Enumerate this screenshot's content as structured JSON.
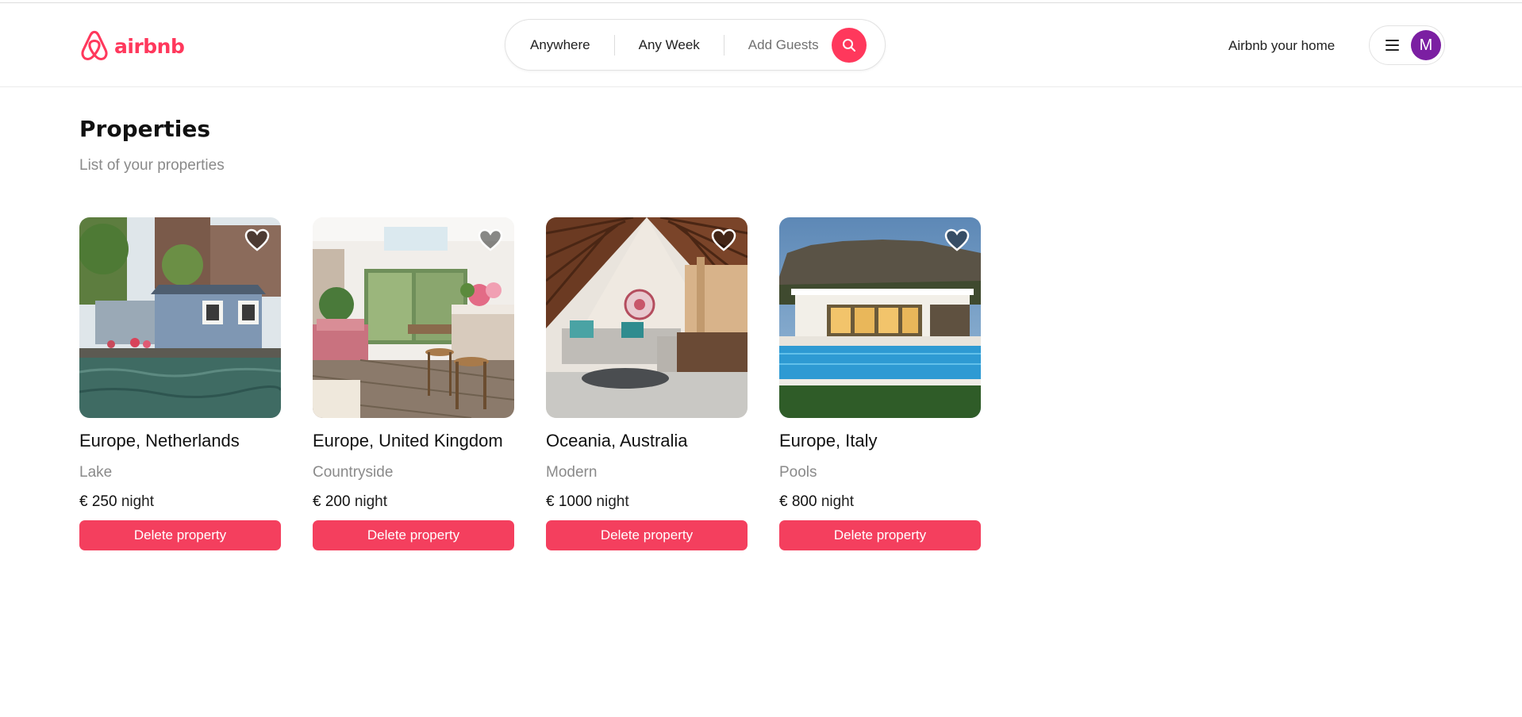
{
  "brand": {
    "name": "airbnb",
    "color": "#ff385c"
  },
  "search": {
    "location_label": "Anywhere",
    "week_label": "Any Week",
    "guests_label": "Add Guests",
    "button_icon": "search-icon"
  },
  "header": {
    "host_link": "Airbnb your home",
    "menu_icon": "hamburger-icon",
    "avatar_initial": "M",
    "avatar_color": "#7b1fa2"
  },
  "page": {
    "title": "Properties",
    "subtitle": "List of your properties"
  },
  "properties": [
    {
      "location": "Europe, Netherlands",
      "category": "Lake",
      "price": "€ 250",
      "unit": "night",
      "action": "Delete property",
      "favorite_icon": "heart-icon"
    },
    {
      "location": "Europe, United Kingdom",
      "category": "Countryside",
      "price": "€ 200",
      "unit": "night",
      "action": "Delete property",
      "favorite_icon": "heart-icon"
    },
    {
      "location": "Oceania, Australia",
      "category": "Modern",
      "price": "€ 1000",
      "unit": "night",
      "action": "Delete property",
      "favorite_icon": "heart-icon"
    },
    {
      "location": "Europe, Italy",
      "category": "Pools",
      "price": "€ 800",
      "unit": "night",
      "action": "Delete property",
      "favorite_icon": "heart-icon"
    }
  ],
  "colors": {
    "accent": "#ff385c",
    "delete_button": "#f43f5e"
  }
}
